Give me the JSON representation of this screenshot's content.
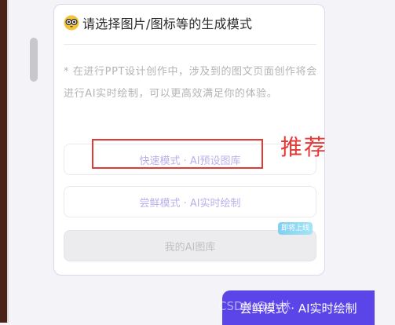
{
  "card": {
    "icon": "owl-emoji-icon",
    "title": "请选择图片/图标等的生成模式",
    "note": "* 在进行PPT设计创作中，涉及到的图文页面创作将会进行AI实时绘制，可以更高效满足你的体验。"
  },
  "modes": {
    "fast_label": "快速模式 · AI预设图库",
    "fresh_label": "尝鲜模式 · AI实时绘制",
    "library_label": "我的AI图库",
    "soon_badge": "即将上线"
  },
  "annotation": {
    "recommend": "推荐",
    "highlight_color": "#e53935"
  },
  "footer": {
    "action_label": "尝鲜模式 · AI实时绘制",
    "watermark": "CSDN @小林"
  },
  "colors": {
    "accent": "#5b44e8",
    "mode_text": "#b9b2ea",
    "badge": "#8fdaf3"
  }
}
